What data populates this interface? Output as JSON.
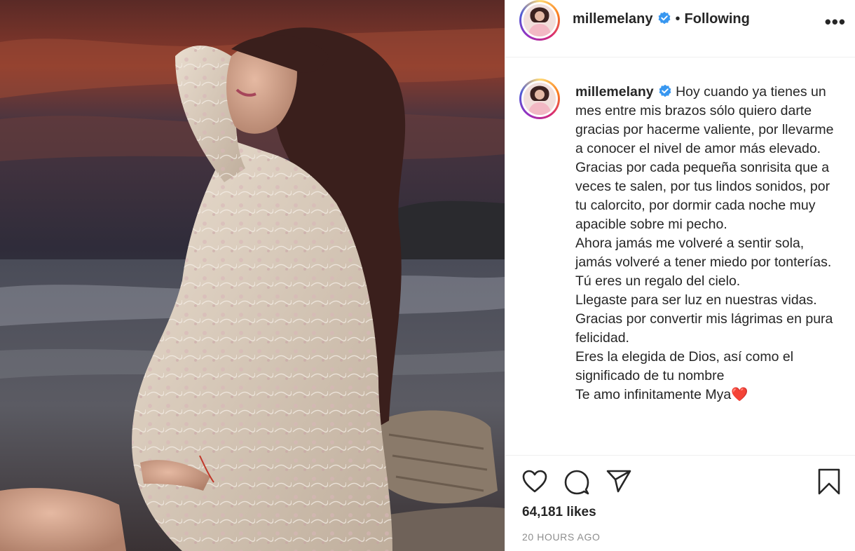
{
  "post": {
    "username": "millemelany",
    "separator": "•",
    "follow_status": "Following",
    "more_label": "•••",
    "photo_alt": "Pregnant woman in lace dress on the beach at sunset"
  },
  "caption": {
    "username": "millemelany",
    "lines": [
      "Hoy cuando ya tienes un mes entre mis brazos sólo quiero darte gracias por hacerme valiente, por llevarme a conocer el nivel de amor más elevado.",
      "Gracias por cada pequeña sonrisita que a veces te salen, por tus lindos sonidos, por tu calorcito, por dormir cada noche muy apacible sobre mi pecho.",
      "Ahora jamás me volveré a sentir sola, jamás volveré a tener miedo por tonterías.",
      "Tú eres un regalo del cielo.",
      "Llegaste para ser luz en nuestras vidas.",
      "Gracias por convertir mis lágrimas en pura felicidad.",
      "Eres la elegida de Dios, así como el significado de tu nombre",
      "Te amo infinitamente Mya❤️"
    ]
  },
  "stats": {
    "likes": "64,181 likes",
    "time": "20 HOURS AGO"
  },
  "icons": [
    "heart-icon",
    "comment-icon",
    "share-icon",
    "bookmark-icon",
    "verified-badge-icon",
    "more-options-icon"
  ],
  "colors": {
    "verified": "#3897f0",
    "text": "#262626",
    "muted": "#8e8e8e",
    "border": "#efefef"
  }
}
